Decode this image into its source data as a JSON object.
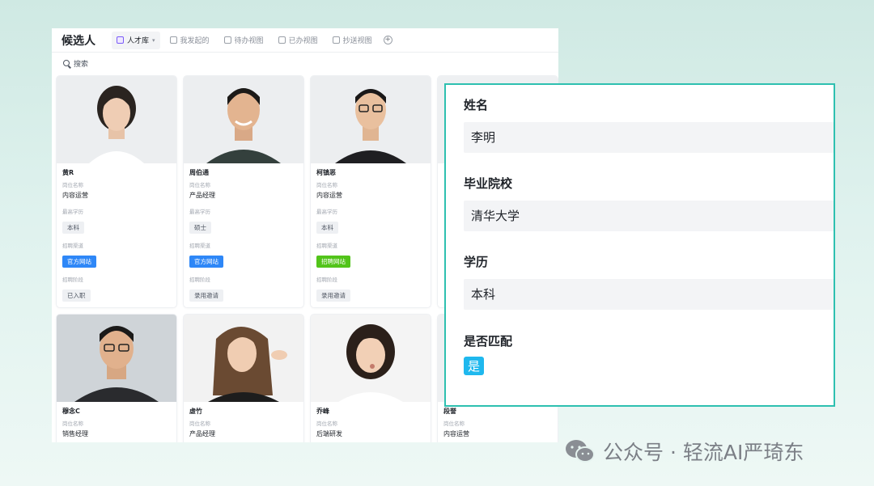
{
  "app": {
    "title": "候选人",
    "tabs": [
      {
        "label": "人才库",
        "active": true
      },
      {
        "label": "我发起的",
        "active": false
      },
      {
        "label": "待办视图",
        "active": false
      },
      {
        "label": "已办视图",
        "active": false
      },
      {
        "label": "抄送视图",
        "active": false
      }
    ],
    "search_label": "搜索"
  },
  "cards": [
    {
      "name": "黄R",
      "position_label": "岗位名称",
      "position": "内容运营",
      "edu_label": "最高学历",
      "edu": "本科",
      "channel_label": "招聘渠道",
      "channel": "官方网站",
      "channel_color": "blue",
      "stage_label": "招聘阶段",
      "stage": "已入职"
    },
    {
      "name": "周伯通",
      "position_label": "岗位名称",
      "position": "产品经理",
      "edu_label": "最高学历",
      "edu": "硕士",
      "channel_label": "招聘渠道",
      "channel": "官方网站",
      "channel_color": "blue",
      "stage_label": "招聘阶段",
      "stage": "录用邀请"
    },
    {
      "name": "柯镇恶",
      "position_label": "岗位名称",
      "position": "内容运营",
      "edu_label": "最高学历",
      "edu": "本科",
      "channel_label": "招聘渠道",
      "channel": "招聘网站",
      "channel_color": "green",
      "stage_label": "招聘阶段",
      "stage": "录用邀请"
    },
    {
      "name": "穆念C",
      "position_label": "岗位名称",
      "position": "销售经理"
    },
    {
      "name": "虚竹",
      "position_label": "岗位名称",
      "position": "产品经理"
    },
    {
      "name": "乔峰",
      "position_label": "岗位名称",
      "position": "后端研发"
    },
    {
      "name": "段誉",
      "position_label": "岗位名称",
      "position": "内容运营"
    }
  ],
  "form": {
    "name_label": "姓名",
    "name_value": "李明",
    "school_label": "毕业院校",
    "school_value": "清华大学",
    "edu_label": "学历",
    "edu_value": "本科",
    "match_label": "是否匹配",
    "match_value": "是"
  },
  "watermark": {
    "text": "公众号 · 轻流AI严琦东"
  },
  "colors": {
    "form_border": "#2ec0b0",
    "match_tag": "#1fb8ee",
    "tag_blue": "#2e87f7",
    "tag_green": "#52c41a"
  }
}
